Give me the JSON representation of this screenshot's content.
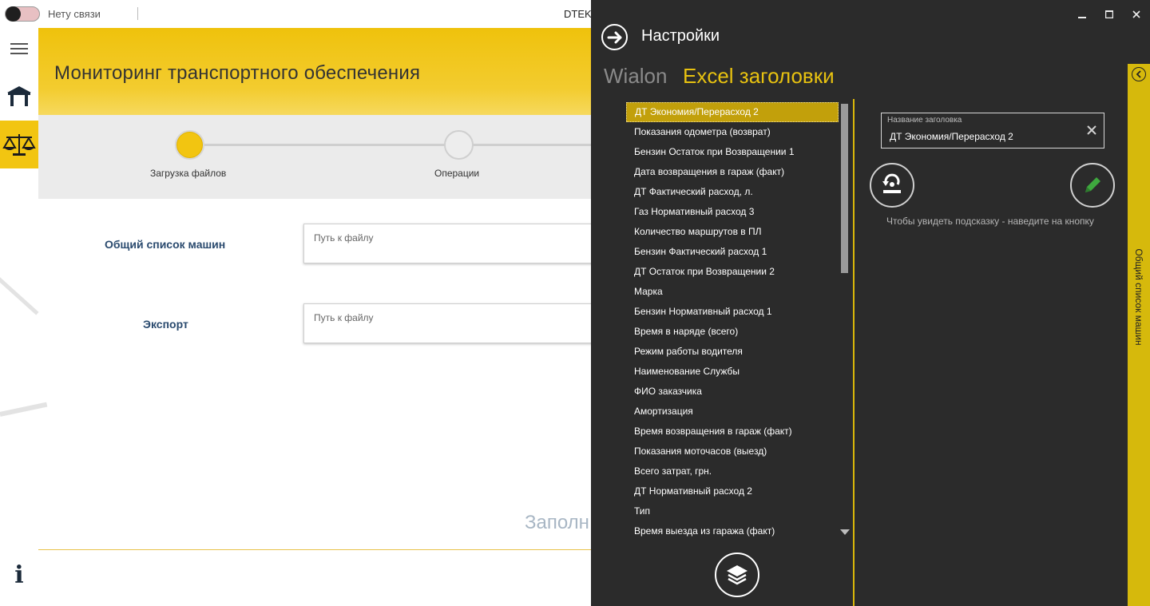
{
  "topbar": {
    "connection_status": "Нету связи",
    "window_title": "DTEK"
  },
  "header": {
    "title": "Мониторинг транспортного обеспечения"
  },
  "steps": [
    {
      "label": "Загрузка файлов",
      "state": "done"
    },
    {
      "label": "Операции",
      "state": "pending"
    }
  ],
  "form": {
    "fields": [
      {
        "label": "Общий список машин",
        "placeholder": "Путь к файлу"
      },
      {
        "label": "Экспорт",
        "placeholder": "Путь к файлу"
      }
    ],
    "bottom_text": "Заполн"
  },
  "colors": {
    "accent": "#f2c511",
    "panel_bg": "#2b2b2b",
    "tab_active": "#e8c210",
    "tab_inactive": "#8a8a8a"
  },
  "settings": {
    "title": "Настройки",
    "tabs": [
      {
        "label": "Wialon",
        "active": false
      },
      {
        "label": "Excel заголовки",
        "active": true
      }
    ],
    "header_items": [
      "ДТ Экономия/Перерасход 2",
      "Показания одометра (возврат)",
      "Бензин Остаток при Возвращении 1",
      "Дата возвращения в гараж (факт)",
      "ДТ Фактический расход, л.",
      "Газ Нормативный расход 3",
      "Количество маршрутов в ПЛ",
      "Бензин Фактический расход 1",
      "ДТ Остаток при Возвращении 2",
      "Марка",
      "Бензин Нормативный расход 1",
      "Время в наряде (всего)",
      "Режим работы водителя",
      "Наименование Службы",
      "ФИО заказчика",
      "Амортизация",
      "Время возвращения в гараж (факт)",
      "Показания моточасов (выезд)",
      "Всего затрат, грн.",
      "ДТ Нормативный расход 2",
      "Тип",
      "Время выезда из гаража (факт)"
    ],
    "selected_index": 0,
    "name_field": {
      "label": "Название заголовка",
      "value": "ДТ Экономия/Перерасход 2"
    },
    "hint": "Чтобы увидеть подсказку - наведите на кнопку",
    "side_tab": "Общий список машин"
  }
}
